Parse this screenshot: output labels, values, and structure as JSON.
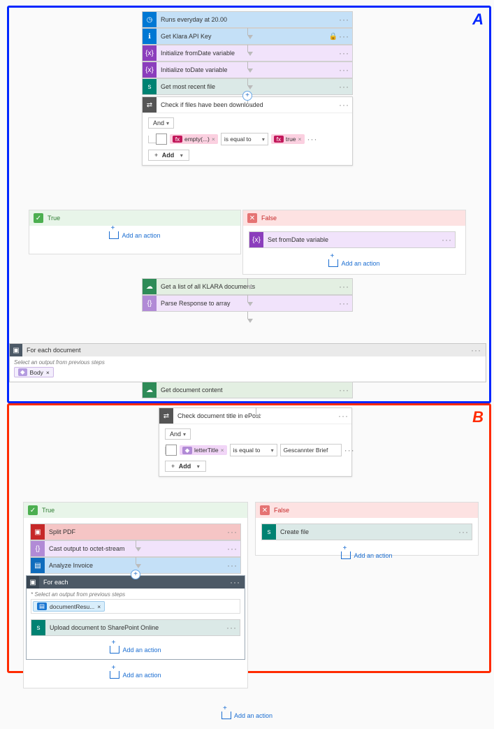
{
  "regions": {
    "A": "A",
    "B": "B"
  },
  "steps": {
    "trigger": "Runs everyday at 20.00",
    "getKey": "Get Klara API Key",
    "initFrom": "Initialize fromDate variable",
    "initTo": "Initialize toDate variable",
    "getRecent": "Get most recent file",
    "checkDownloaded": "Check if files have been downloaded",
    "setFrom": "Set fromDate variable",
    "getList": "Get a list of all KLARA documents",
    "parseResp": "Parse Response to array",
    "forEachDoc": "For each document",
    "getDocContent": "Get document content",
    "checkTitle": "Check document title in ePost",
    "splitPdf": "Split PDF",
    "castOutput": "Cast output to octet-stream",
    "analyze": "Analyze Invoice",
    "forEachInner": "For each",
    "upload": "Upload document to SharePoint Online",
    "createFile": "Create file"
  },
  "cond1": {
    "logic": "And",
    "left": "empty(...)",
    "op": "is equal to",
    "right": "true",
    "addLabel": "Add"
  },
  "cond2": {
    "logic": "And",
    "left": "letterTitle",
    "op": "is equal to",
    "right": "Gescannter Brief",
    "addLabel": "Add"
  },
  "branch": {
    "true": "True",
    "false": "False"
  },
  "outer": {
    "hint": "Select an output from previous steps",
    "token": "Body"
  },
  "inner": {
    "hint": "* Select an output from previous steps",
    "token": "documentResu..."
  },
  "common": {
    "addAction": "Add an action",
    "menu": "···"
  }
}
